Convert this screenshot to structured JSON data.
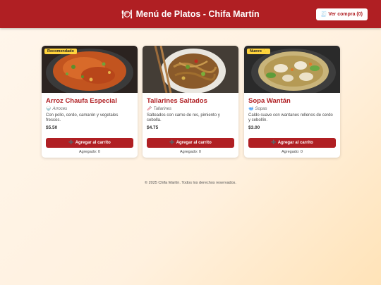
{
  "header": {
    "title": "Menú de Platos - Chifa Martín",
    "title_icon": "plate-icon",
    "cart_label": "Ver compra (0)",
    "cart_icon": "receipt-icon",
    "brand_color": "#b01f23"
  },
  "dishes": [
    {
      "badge": "Recomendado",
      "name": "Arroz Chaufa Especial",
      "category": "Arroces",
      "category_icon": "bowl-icon",
      "description": "Con pollo, cerdo, camarón y vegetales frescos.",
      "price": "$5.50",
      "button_label": "Agregar al carrito",
      "added_text": "Agregado: 0"
    },
    {
      "badge": "",
      "name": "Tallarines Saltados",
      "category": "Tallarines",
      "category_icon": "chopsticks-icon",
      "description": "Salteados con carne de res, pimiento y cebolla.",
      "price": "$4.75",
      "button_label": "Agregar al carrito",
      "added_text": "Agregado: 0"
    },
    {
      "badge": "Nuevo ✨",
      "name": "Sopa Wantán",
      "category": "Sopas",
      "category_icon": "soup-icon",
      "description": "Caldo suave con wantanes rellenos de cerdo y cebollín.",
      "price": "$3.00",
      "button_label": "Agregar al carrito",
      "added_text": "Agregado: 0"
    }
  ],
  "footer": {
    "text": "© 2025 Chifa Martín. Todos los derechos reservados."
  }
}
